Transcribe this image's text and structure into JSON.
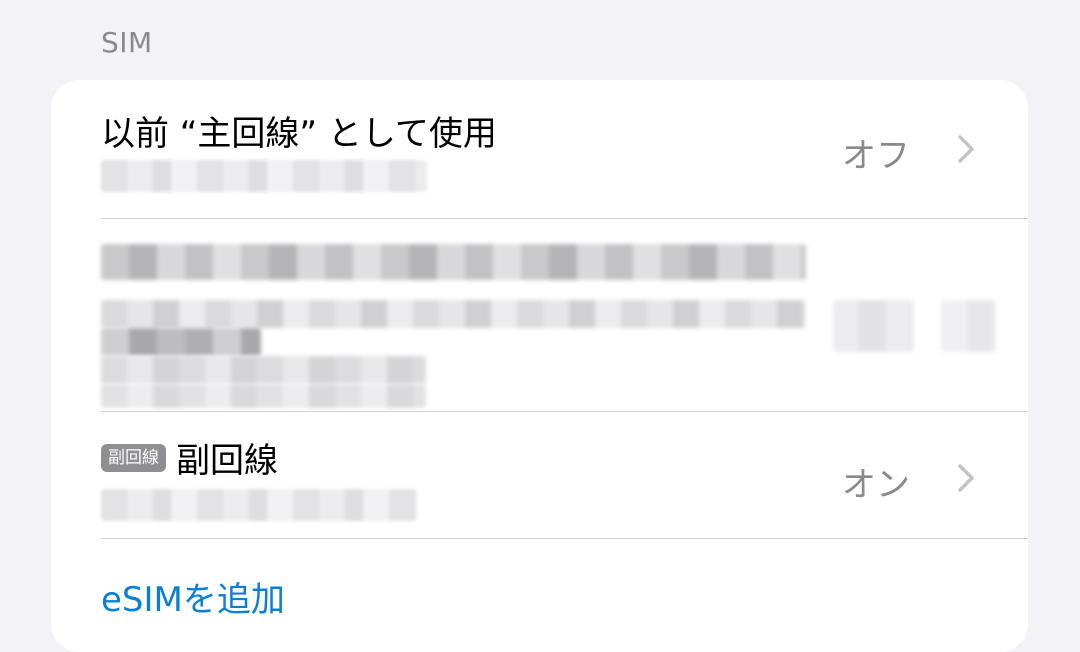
{
  "section": {
    "header": "SIM"
  },
  "rows": {
    "primary": {
      "title": "以前 “主回線” として使用",
      "value": "オフ"
    },
    "secondary": {
      "badge": "副回線",
      "title": "副回線",
      "value": "オン"
    },
    "add_esim": {
      "label": "eSIMを追加"
    }
  },
  "icons": {
    "chevron": "chevron-right-icon"
  },
  "colors": {
    "background": "#f2f2f7",
    "card": "#ffffff",
    "link": "#0a7fd6",
    "secondary_text": "#8a8a8e",
    "badge": "#8e8e93"
  }
}
